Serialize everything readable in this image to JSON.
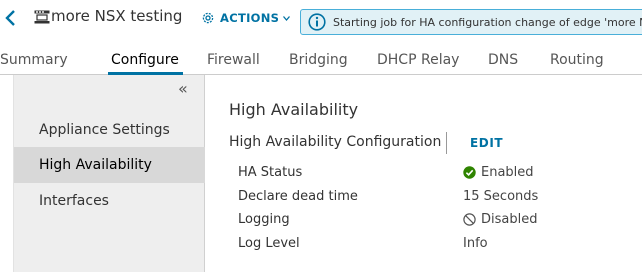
{
  "header": {
    "title": "more NSX testing",
    "actions_label": "ACTIONS",
    "banner_text": "Starting job for HA configuration change of edge 'more NSX testing'"
  },
  "tabs": [
    {
      "label": "Summary"
    },
    {
      "label": "Configure"
    },
    {
      "label": "Firewall"
    },
    {
      "label": "Bridging"
    },
    {
      "label": "DHCP Relay"
    },
    {
      "label": "DNS"
    },
    {
      "label": "Routing"
    }
  ],
  "active_tab": "Configure",
  "sidebar": {
    "collapse_glyph": "«",
    "items": [
      {
        "label": "Appliance Settings"
      },
      {
        "label": "High Availability"
      },
      {
        "label": "Interfaces"
      }
    ]
  },
  "main": {
    "heading": "High Availability",
    "subheading": "High Availability Configuration",
    "edit_label": "EDIT",
    "rows": [
      {
        "label": "HA Status",
        "value": "Enabled",
        "icon": "check-circle-icon"
      },
      {
        "label": "Declare dead time",
        "value": "15 Seconds"
      },
      {
        "label": "Logging",
        "value": "Disabled",
        "icon": "ban-icon"
      },
      {
        "label": "Log Level",
        "value": "Info"
      }
    ]
  },
  "colors": {
    "accent": "#0072a3",
    "banner_bg": "#e1f1f6",
    "banner_border": "#49afd9",
    "success": "#2f8400"
  }
}
